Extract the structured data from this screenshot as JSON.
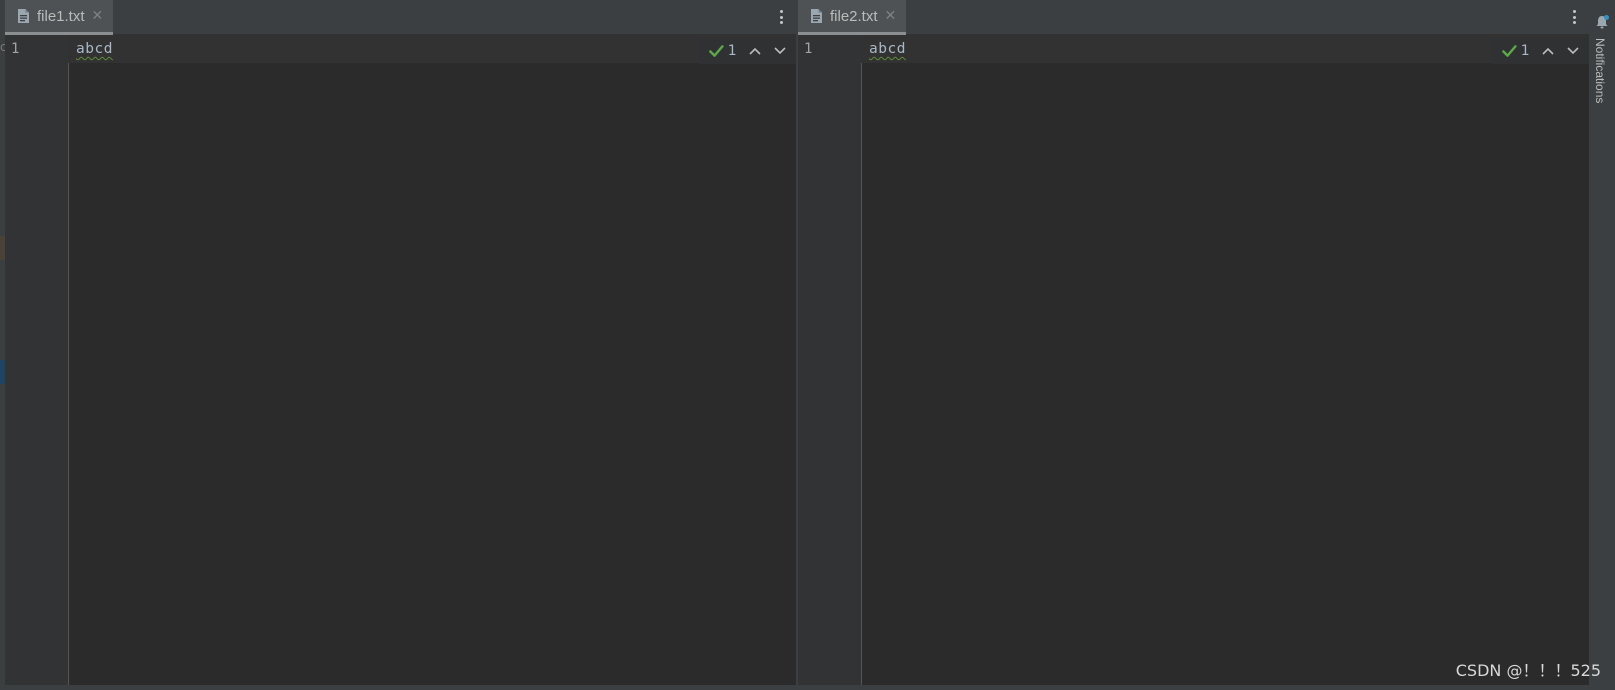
{
  "left_pane": {
    "tab_label": "file1.txt",
    "close_glyph": "✕",
    "line_number": "1",
    "code_text": "abcd",
    "inspection_count": "1"
  },
  "right_pane": {
    "tab_label": "file2.txt",
    "close_glyph": "✕",
    "line_number": "1",
    "code_text": "abcd",
    "inspection_count": "1"
  },
  "left_strip_char": "c",
  "notifications_label": "Notifications",
  "watermark": "CSDN @！！！525",
  "icons": {
    "file": "text-file-icon",
    "menu": "vertical-ellipsis-icon",
    "check": "checkmark-icon",
    "up": "chevron-up-icon",
    "down": "chevron-down-icon",
    "bell": "bell-icon"
  },
  "colors": {
    "editor_bg": "#2b2b2b",
    "gutter_bg": "#313335",
    "tab_bg": "#4e5254",
    "check_green": "#5ea84a",
    "wavy_underline": "#5f8a3a"
  }
}
